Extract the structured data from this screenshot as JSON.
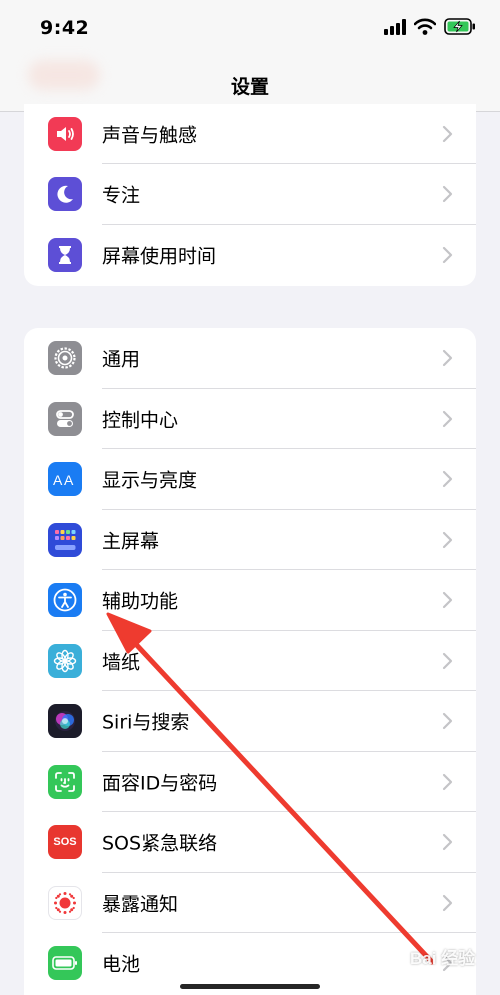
{
  "status_bar": {
    "time": "9:42"
  },
  "nav": {
    "title": "设置"
  },
  "groups": [
    {
      "items": [
        {
          "label": "声音与触感",
          "icon": "speaker-icon",
          "color": "#f23a55"
        },
        {
          "label": "专注",
          "icon": "moon-icon",
          "color": "#5d4fd6"
        },
        {
          "label": "屏幕使用时间",
          "icon": "hourglass-icon",
          "color": "#5d4fd6"
        }
      ]
    },
    {
      "items": [
        {
          "label": "通用",
          "icon": "gear-icon",
          "color": "#8e8e93"
        },
        {
          "label": "控制中心",
          "icon": "toggles-icon",
          "color": "#8e8e93"
        },
        {
          "label": "显示与亮度",
          "icon": "text-size-icon",
          "color": "#1a7cf3"
        },
        {
          "label": "主屏幕",
          "icon": "home-screen-grid-icon",
          "color": "#2f4bd8"
        },
        {
          "label": "辅助功能",
          "icon": "accessibility-icon",
          "color": "#1a7cf3"
        },
        {
          "label": "墙纸",
          "icon": "flower-icon",
          "color": "#3aafd9"
        },
        {
          "label": "Siri与搜索",
          "icon": "siri-icon",
          "color": "#1c1c2a"
        },
        {
          "label": "面容ID与密码",
          "icon": "face-id-icon",
          "color": "#34c759"
        },
        {
          "label": "SOS紧急联络",
          "icon": "sos-icon",
          "color": "#e8362f",
          "icon_text": "SOS"
        },
        {
          "label": "暴露通知",
          "icon": "exposure-icon",
          "color": "#ffffff"
        },
        {
          "label": "电池",
          "icon": "battery-icon",
          "color": "#34c759"
        }
      ]
    }
  ],
  "watermark": {
    "text": "Bai 经验"
  },
  "colors": {
    "background": "#f2f2f7",
    "annotation_arrow": "#ee3b2f"
  }
}
